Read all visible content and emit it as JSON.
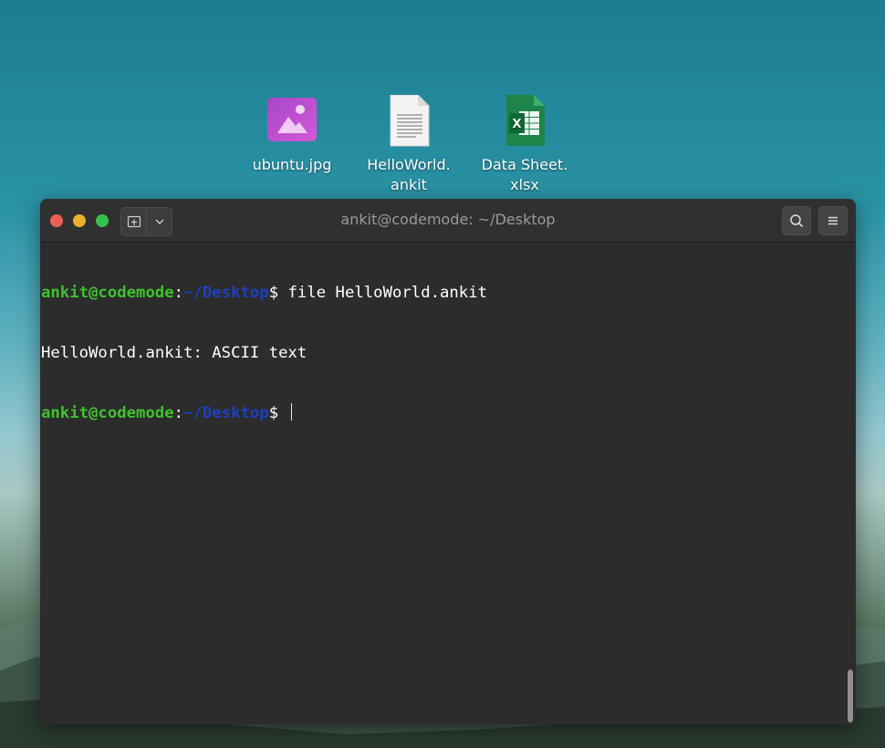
{
  "desktop": {
    "icons": [
      {
        "label": "ubuntu.jpg",
        "icon": "image-file-icon",
        "color": "#c053d8"
      },
      {
        "label": "HelloWorld.\nankit",
        "icon": "text-document-icon",
        "color": "#f2f2f2"
      },
      {
        "label": "Data Sheet.\nxlsx",
        "icon": "spreadsheet-file-icon",
        "color": "#1d7d44"
      }
    ]
  },
  "terminal": {
    "title": "ankit@codemode: ~/Desktop",
    "lines": [
      {
        "user": "ankit@codemode",
        "sep": ":",
        "path": "~/Desktop",
        "prompt": "$ ",
        "command": "file HelloWorld.ankit"
      },
      {
        "output": "HelloWorld.ankit: ASCII text"
      },
      {
        "user": "ankit@codemode",
        "sep": ":",
        "path": "~/Desktop",
        "prompt": "$ ",
        "command": ""
      }
    ],
    "colors": {
      "user": "#3ec12f",
      "path": "#1c3fbf",
      "close": "#ec5f57",
      "minimize": "#e9b12f",
      "maximize": "#35c14b"
    }
  }
}
